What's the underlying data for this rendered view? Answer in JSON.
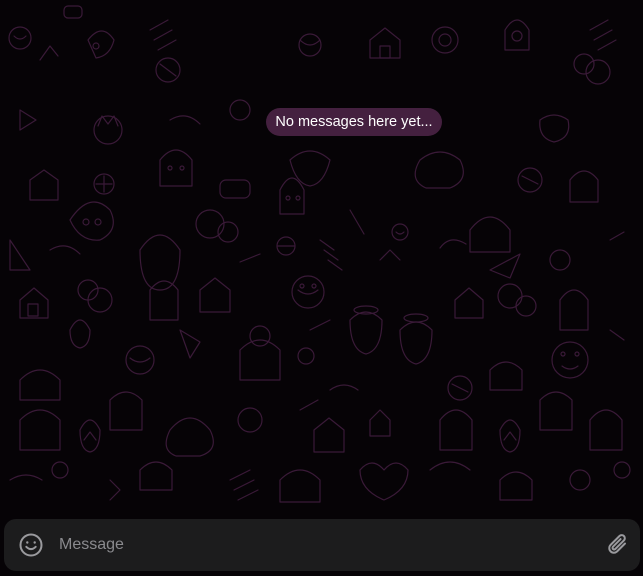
{
  "theme": {
    "background": "#060306",
    "doodle_color": "#3a1a38",
    "pill_background": "#44203f",
    "composer_background": "#1c1c1d",
    "icon_color": "#9a9a9e"
  },
  "chat": {
    "empty_state": "No messages here yet..."
  },
  "composer": {
    "placeholder": "Message",
    "value": "",
    "emoji_icon": "smiley-icon",
    "attach_icon": "paperclip-icon"
  }
}
